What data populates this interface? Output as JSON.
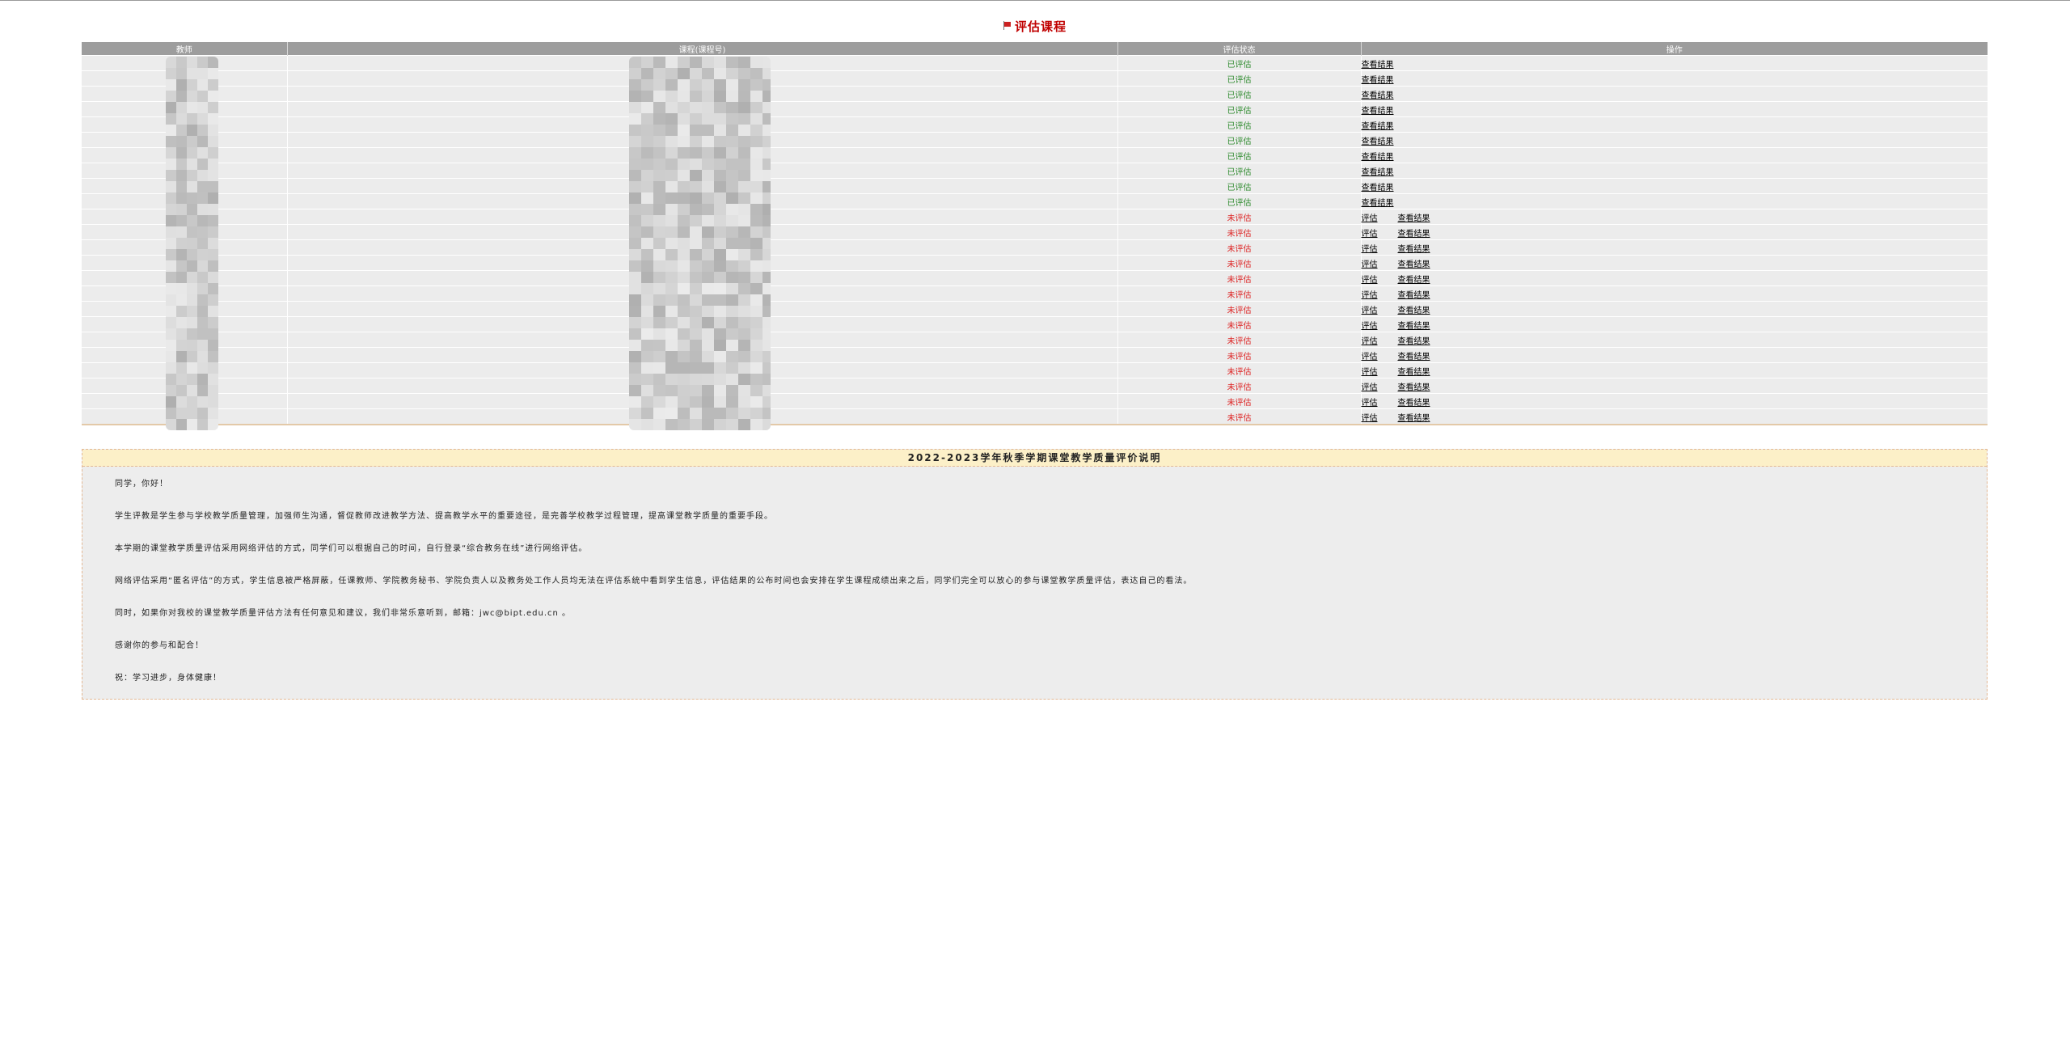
{
  "page_title": "评估课程",
  "table": {
    "headers": [
      "教师",
      "课程(课程号)",
      "评估状态",
      "操作"
    ],
    "rows": [
      {
        "status": "已评估",
        "state": "done"
      },
      {
        "status": "已评估",
        "state": "done"
      },
      {
        "status": "已评估",
        "state": "done"
      },
      {
        "status": "已评估",
        "state": "done"
      },
      {
        "status": "已评估",
        "state": "done"
      },
      {
        "status": "已评估",
        "state": "done"
      },
      {
        "status": "已评估",
        "state": "done"
      },
      {
        "status": "已评估",
        "state": "done"
      },
      {
        "status": "已评估",
        "state": "done"
      },
      {
        "status": "已评估",
        "state": "done"
      },
      {
        "status": "未评估",
        "state": "todo"
      },
      {
        "status": "未评估",
        "state": "todo"
      },
      {
        "status": "未评估",
        "state": "todo"
      },
      {
        "status": "未评估",
        "state": "todo"
      },
      {
        "status": "未评估",
        "state": "todo"
      },
      {
        "status": "未评估",
        "state": "todo"
      },
      {
        "status": "未评估",
        "state": "todo"
      },
      {
        "status": "未评估",
        "state": "todo"
      },
      {
        "status": "未评估",
        "state": "todo"
      },
      {
        "status": "未评估",
        "state": "todo"
      },
      {
        "status": "未评估",
        "state": "todo"
      },
      {
        "status": "未评估",
        "state": "todo"
      },
      {
        "status": "未评估",
        "state": "todo"
      },
      {
        "status": "未评估",
        "state": "todo"
      }
    ],
    "evaluate_label": "评估",
    "view_result_label": "查看结果"
  },
  "notice": {
    "title": "2022-2023学年秋季学期课堂教学质量评价说明",
    "paragraphs": [
      "同学，你好！",
      "学生评教是学生参与学校教学质量管理，加强师生沟通，督促教师改进教学方法、提高教学水平的重要途径，是完善学校教学过程管理，提高课堂教学质量的重要手段。",
      "本学期的课堂教学质量评估采用网络评估的方式，同学们可以根据自己的时间，自行登录“综合教务在线”进行网络评估。",
      "网络评估采用“匿名评估”的方式，学生信息被严格屏蔽，任课教师、学院教务秘书、学院负责人以及教务处工作人员均无法在评估系统中看到学生信息，评估结果的公布时间也会安排在学生课程成绩出来之后，同学们完全可以放心的参与课堂教学质量评估，表达自己的看法。",
      "同时，如果你对我校的课堂教学质量评估方法有任何意见和建议，我们非常乐意听到，邮箱：jwc@bipt.edu.cn 。",
      "感谢你的参与和配合！",
      "祝：学习进步，身体健康！"
    ]
  },
  "colors": {
    "header_bg": "#9d9d9d",
    "row_bg": "#ececec",
    "status_done": "#2e8b2e",
    "status_todo": "#dd2222",
    "title_red": "#c00000",
    "notice_title_bg": "#fcf0c8",
    "notice_border": "#e3b894"
  }
}
